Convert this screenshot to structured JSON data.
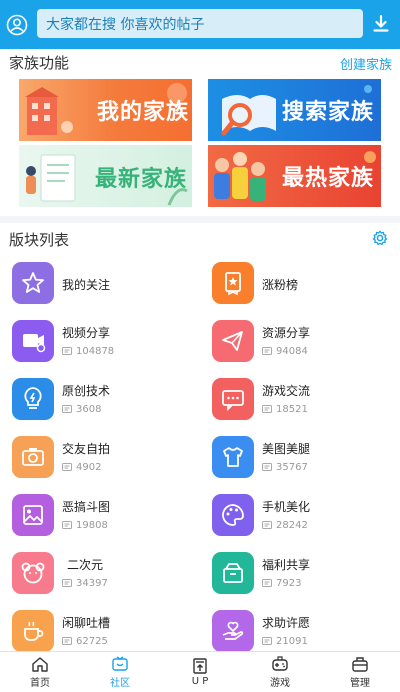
{
  "search": {
    "placeholder": "大家都在搜 你喜欢的帖子"
  },
  "family": {
    "title": "家族功能",
    "create_link": "创建家族",
    "banners": [
      "我的家族",
      "搜索家族",
      "最新家族",
      "最热家族"
    ]
  },
  "board": {
    "title": "版块列表",
    "items": [
      {
        "name": "我的关注",
        "count": "",
        "color": "#8e6ee3",
        "icon": "star-icon"
      },
      {
        "name": "涨粉榜",
        "count": "",
        "color": "#f97f2c",
        "icon": "ranking-icon"
      },
      {
        "name": "视频分享",
        "count": "104878",
        "color": "#8c5cf0",
        "icon": "video-icon"
      },
      {
        "name": "资源分享",
        "count": "94084",
        "color": "#f56b71",
        "icon": "paper-plane-icon"
      },
      {
        "name": "原创技术",
        "count": "3608",
        "color": "#2b8de8",
        "icon": "lightbulb-icon"
      },
      {
        "name": "游戏交流",
        "count": "18521",
        "color": "#f26060",
        "icon": "chat-icon"
      },
      {
        "name": "交友自拍",
        "count": "4902",
        "color": "#f6a155",
        "icon": "camera-icon"
      },
      {
        "name": "美图美腿",
        "count": "35767",
        "color": "#3b8ef1",
        "icon": "shirt-icon"
      },
      {
        "name": "恶搞斗图",
        "count": "19808",
        "color": "#b35fe0",
        "icon": "picture-icon"
      },
      {
        "name": "手机美化",
        "count": "28242",
        "color": "#7f61ee",
        "icon": "palette-icon"
      },
      {
        "name": "二次元",
        "count": "34397",
        "color": "#f77b8c",
        "icon": "bear-icon"
      },
      {
        "name": "福利共享",
        "count": "7923",
        "color": "#23b79a",
        "icon": "gift-box-icon"
      },
      {
        "name": "闲聊吐槽",
        "count": "62725",
        "color": "#f9a24e",
        "icon": "coffee-icon"
      },
      {
        "name": "求助许愿",
        "count": "21091",
        "color": "#b268e8",
        "icon": "heart-hand-icon"
      }
    ]
  },
  "nav": {
    "items": [
      {
        "label": "首页",
        "icon": "home-icon"
      },
      {
        "label": "社区",
        "icon": "community-icon",
        "active": true
      },
      {
        "label": "U P",
        "icon": "upload-icon"
      },
      {
        "label": "游戏",
        "icon": "gamepad-icon"
      },
      {
        "label": "管理",
        "icon": "manage-icon"
      }
    ]
  },
  "colors": {
    "accent": "#1aa3e8"
  }
}
